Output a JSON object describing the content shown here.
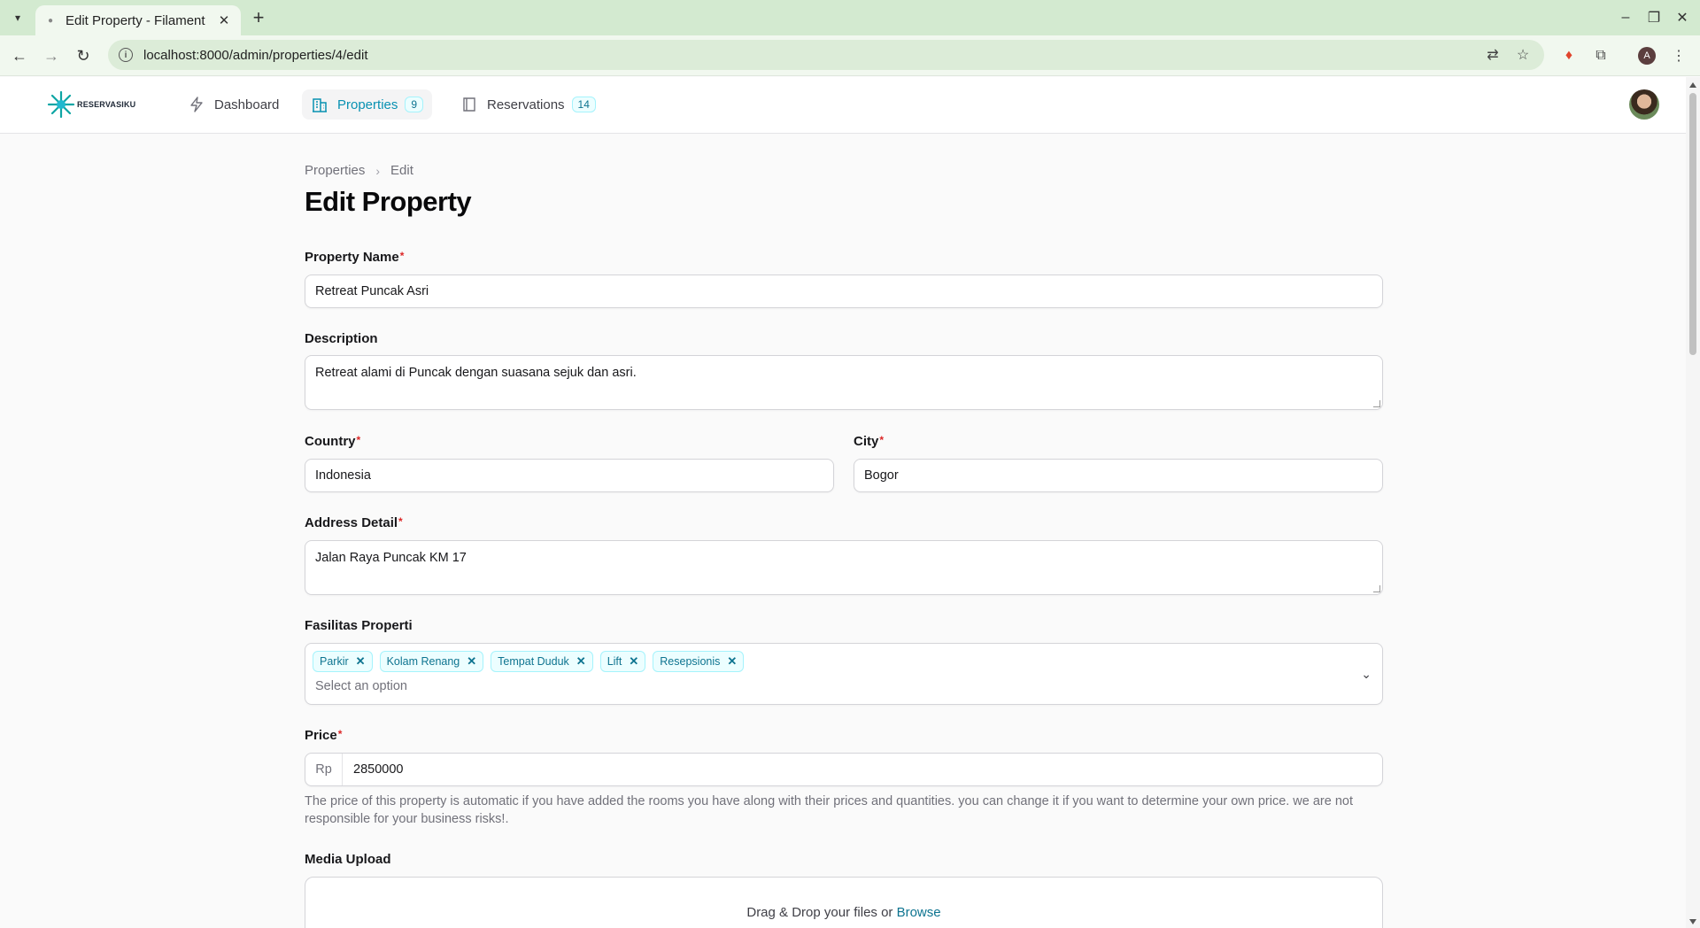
{
  "browser": {
    "tab_title": "Edit Property - Filament",
    "url": "localhost:8000/admin/properties/4/edit",
    "profile_initial": "A"
  },
  "app": {
    "logo_text": "RESERVASIKU",
    "nav": [
      {
        "label": "Dashboard",
        "icon": "bolt-icon"
      },
      {
        "label": "Properties",
        "icon": "building-icon",
        "badge": "9",
        "active": true
      },
      {
        "label": "Reservations",
        "icon": "book-icon",
        "badge": "14"
      }
    ],
    "accent_color": "#0891b2"
  },
  "breadcrumb": {
    "root": "Properties",
    "current": "Edit"
  },
  "page": {
    "title": "Edit Property"
  },
  "form": {
    "property_name": {
      "label": "Property Name",
      "value": "Retreat Puncak Asri",
      "required": true
    },
    "description": {
      "label": "Description",
      "value": "Retreat alami di Puncak dengan suasana sejuk dan asri."
    },
    "country": {
      "label": "Country",
      "value": "Indonesia",
      "required": true
    },
    "city": {
      "label": "City",
      "value": "Bogor",
      "required": true
    },
    "address": {
      "label": "Address Detail",
      "value": "Jalan Raya Puncak KM 17",
      "required": true
    },
    "facilities": {
      "label": "Fasilitas Properti",
      "selected": [
        "Parkir",
        "Kolam Renang",
        "Tempat Duduk",
        "Lift",
        "Resepsionis"
      ],
      "placeholder": "Select an option"
    },
    "price": {
      "label": "Price",
      "prefix": "Rp",
      "value": "2850000",
      "required": true,
      "helper": "The price of this property is automatic if you have added the rooms you have along with their prices and quantities. you can change it if you want to determine your own price. we are not responsible for your business risks!."
    },
    "media": {
      "label": "Media Upload",
      "drop_text": "Drag & Drop your files or",
      "browse_text": "Browse"
    }
  }
}
